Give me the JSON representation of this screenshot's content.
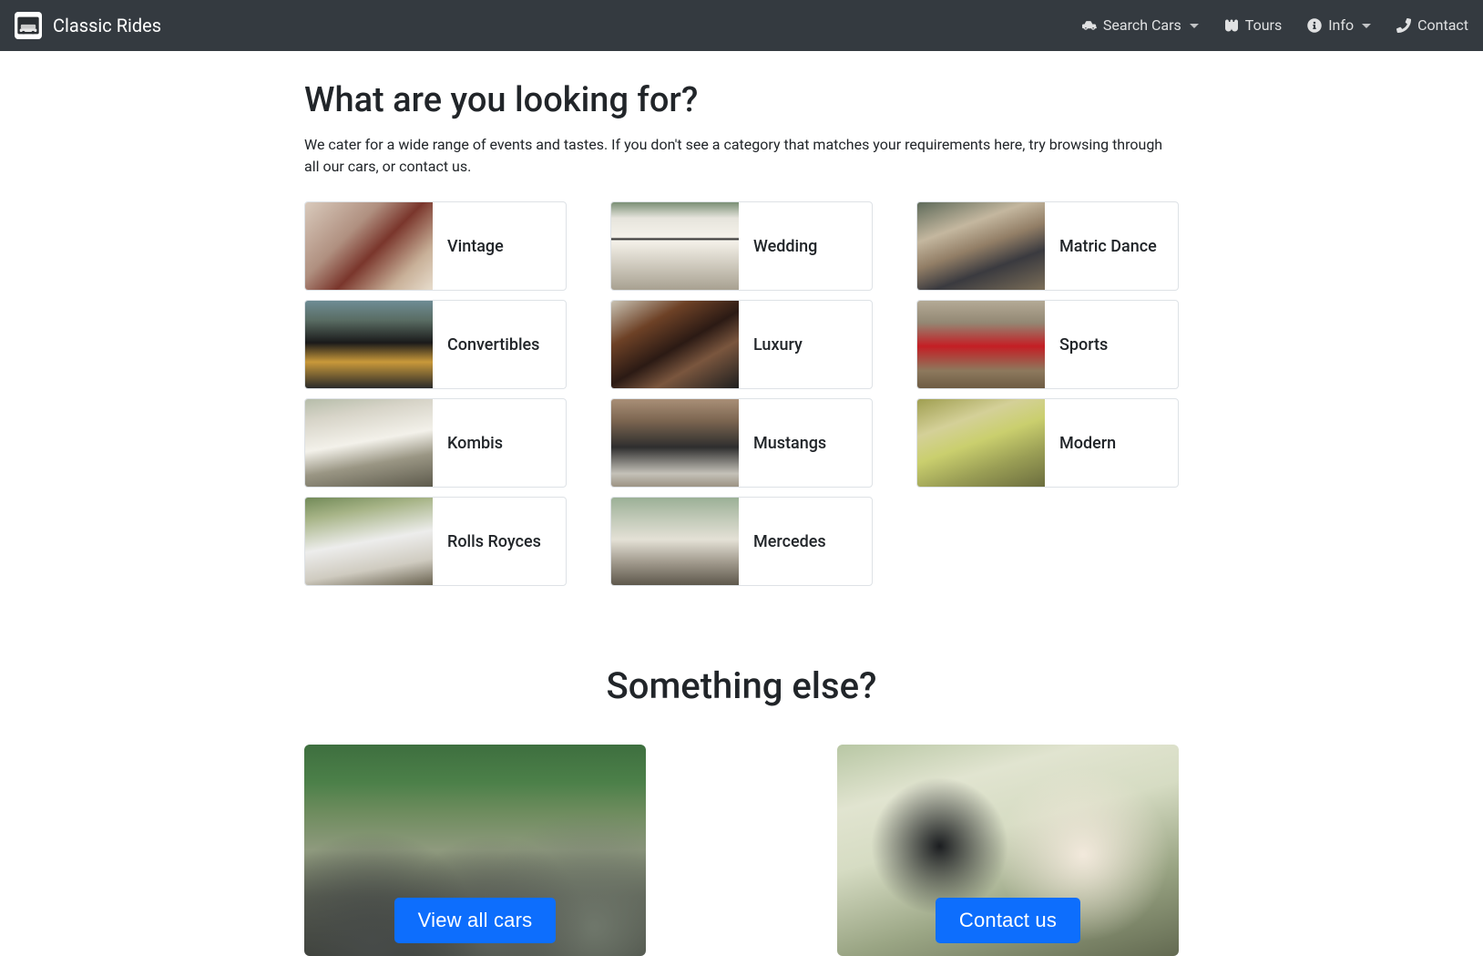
{
  "brand": {
    "name": "Classic Rides"
  },
  "nav": {
    "search": "Search Cars",
    "tours": "Tours",
    "info": "Info",
    "contact": "Contact"
  },
  "section": {
    "title": "What are you looking for?",
    "subtitle": "We cater for a wide range of events and tastes. If you don't see a category that matches your requirements here, try browsing through all our cars, or contact us."
  },
  "categories": [
    {
      "label": "Vintage",
      "thumbClass": "thumb-vintage"
    },
    {
      "label": "Wedding",
      "thumbClass": "thumb-wedding"
    },
    {
      "label": "Matric Dance",
      "thumbClass": "thumb-matric"
    },
    {
      "label": "Convertibles",
      "thumbClass": "thumb-conv"
    },
    {
      "label": "Luxury",
      "thumbClass": "thumb-lux"
    },
    {
      "label": "Sports",
      "thumbClass": "thumb-sports"
    },
    {
      "label": "Kombis",
      "thumbClass": "thumb-kombi"
    },
    {
      "label": "Mustangs",
      "thumbClass": "thumb-mustang"
    },
    {
      "label": "Modern",
      "thumbClass": "thumb-modern"
    },
    {
      "label": "Rolls Royces",
      "thumbClass": "thumb-rolls"
    },
    {
      "label": "Mercedes",
      "thumbClass": "thumb-merc"
    }
  ],
  "else": {
    "title": "Something else?",
    "viewAll": "View all cars",
    "contactUs": "Contact us"
  },
  "colors": {
    "navbar_bg": "#343a40",
    "primary": "#0d6efd",
    "card_border": "#dee2e6"
  }
}
